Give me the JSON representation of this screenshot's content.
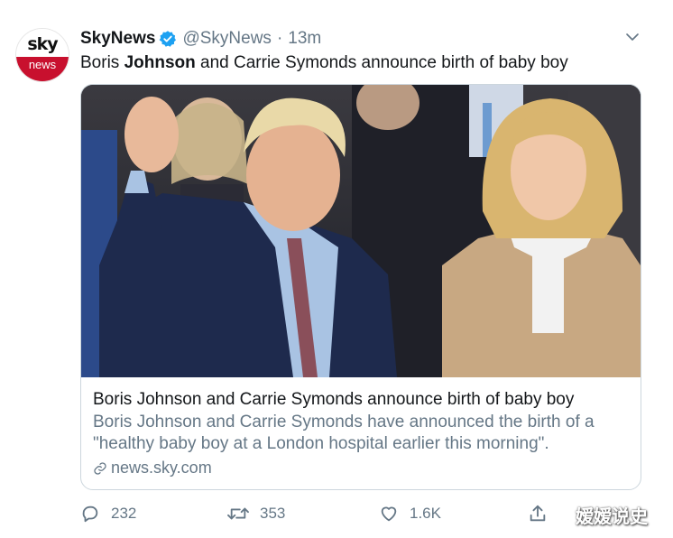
{
  "account": {
    "avatar_top": "sky",
    "avatar_bottom": "news",
    "name": "SkyNews",
    "handle": "@SkyNews",
    "separator": "·",
    "time": "13m"
  },
  "tweet": {
    "text_pre": "Boris ",
    "text_bold": "Johnson",
    "text_post": " and Carrie Symonds announce birth of baby boy"
  },
  "card": {
    "title": "Boris Johnson and Carrie Symonds announce birth of baby boy",
    "description": "Boris Johnson and Carrie Symonds have announced the birth of a \"healthy baby boy at a London hospital earlier this morning\".",
    "domain": "news.sky.com"
  },
  "actions": {
    "replies": "232",
    "retweets": "353",
    "likes": "1.6K"
  },
  "watermark": "嫒嫒说史",
  "colors": {
    "brand_red": "#c8102e",
    "verified_blue": "#1da1f2",
    "muted_text": "#657786"
  }
}
